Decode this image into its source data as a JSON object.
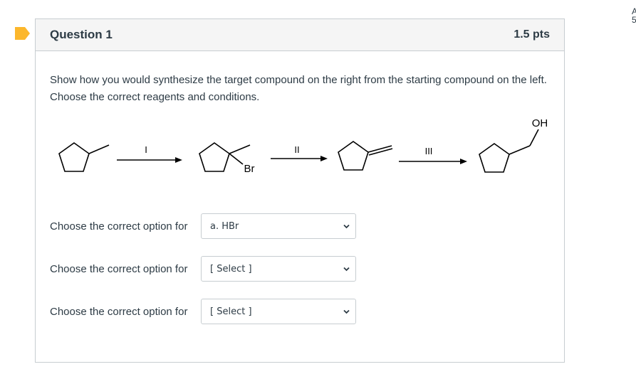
{
  "question": {
    "title": "Question 1",
    "points": "1.5 pts",
    "prompt": "Show how you would synthesize the target compound on the right from the starting compound on the left. Choose the correct reagents and conditions."
  },
  "scheme": {
    "step_labels": [
      "I",
      "II",
      "III"
    ],
    "substituents": {
      "bromo": "Br",
      "hydroxyl": "OH"
    }
  },
  "dropdowns": [
    {
      "label": "Choose the correct option for",
      "selected": "a. HBr"
    },
    {
      "label": "Choose the correct option for",
      "selected": "[ Select ]"
    },
    {
      "label": "Choose the correct option for",
      "selected": "[ Select ]"
    }
  ],
  "colors": {
    "flag": "#fcb72c",
    "border": "#c7cdd1",
    "text": "#2d3b45"
  },
  "icons": [
    "bookmark-flag-icon",
    "chevron-down-icon"
  ],
  "edge_text": [
    "A",
    "5"
  ]
}
